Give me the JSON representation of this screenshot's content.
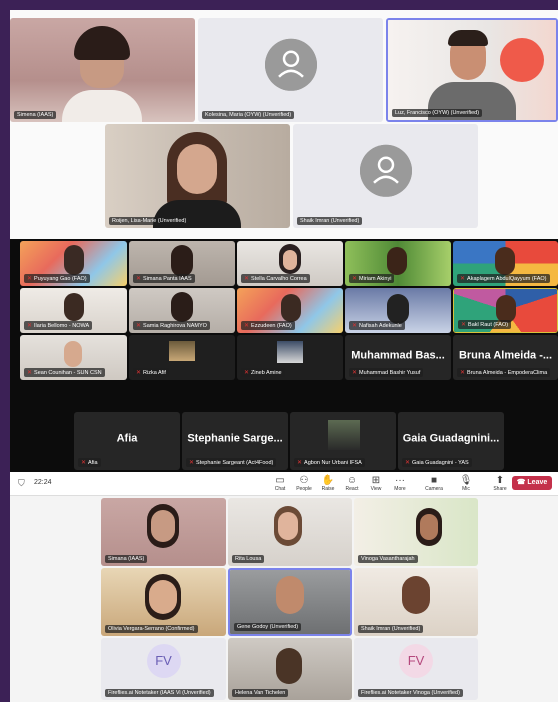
{
  "top_panel": {
    "tiles": [
      {
        "name": "Simena (IAAS)"
      },
      {
        "name": "Kolesina, Maria (OYW) (Unverified)"
      },
      {
        "name": "Luz, Francisco (OYW) (Unverified)"
      },
      {
        "name": "Roijen, Lisa-Marie (Unverified)"
      },
      {
        "name": "Shaik Imran (Unverified)"
      }
    ]
  },
  "grid_panel": {
    "tiles": [
      {
        "name": "Puyuyang Gao (FAO)"
      },
      {
        "name": "Simana Panta IAAS"
      },
      {
        "name": "Stella Carvalho Correa"
      },
      {
        "name": "Miriam Akinyi"
      },
      {
        "name": "Akaplagem AbdulQayyum (FAO)"
      },
      {
        "name": "Ilaria Bellomo - NOWA"
      },
      {
        "name": "Samia Raghirova NAMYO"
      },
      {
        "name": "Ezzudeen (FAO)"
      },
      {
        "name": "Nafisah Adekunle"
      },
      {
        "name": "Bakl Raut (FAO)"
      },
      {
        "name": "Sean Counihan - SUN CSN"
      },
      {
        "name": "Rizka Afif"
      },
      {
        "name": "Zineb Amine"
      },
      {
        "name": "Muhammad Bashir Yusuf",
        "display": "Muhammad Bas..."
      },
      {
        "name": "Bruna Almeida - EmpoderaClima",
        "display": "Bruna Almeida -..."
      },
      {
        "name": "Afia",
        "display": "Afia"
      },
      {
        "name": "Stephanie Sargeant (Act4Food)",
        "display": "Stephanie Sarge..."
      },
      {
        "name": "Agbon Nur Urbani IFSA"
      },
      {
        "name": "Gaia Guadagnini - YAS",
        "display": "Gaia Guadagnini..."
      }
    ]
  },
  "toolbar": {
    "security_label": "⛉",
    "time": "22:24",
    "items": [
      {
        "label": "Chat",
        "icon": "chat-icon"
      },
      {
        "label": "People",
        "icon": "people-icon"
      },
      {
        "label": "Raise",
        "icon": "hand-icon"
      },
      {
        "label": "React",
        "icon": "react-icon"
      },
      {
        "label": "View",
        "icon": "grid-icon"
      },
      {
        "label": "More",
        "icon": "more-icon"
      },
      {
        "label": "Camera",
        "icon": "camera-icon"
      },
      {
        "label": "Mic",
        "icon": "mic-icon"
      },
      {
        "label": "Share",
        "icon": "share-icon"
      }
    ],
    "leave_label": "Leave"
  },
  "bottom_panel": {
    "tiles": [
      {
        "name": "Simana (IAAS)"
      },
      {
        "name": "Rita Lousa"
      },
      {
        "name": "Vinoga Vasantharajah"
      },
      {
        "name": "Olivia Vergara-Serrano (Confirmed)"
      },
      {
        "name": "Gene Godoy (Unverified)"
      },
      {
        "name": "Shaik Imran (Unverified)"
      },
      {
        "name": "Fireflies.ai Notetaker (IAAS Vi (Unverified)",
        "initials": "FV"
      },
      {
        "name": "Helena Van Tichelen"
      },
      {
        "name": "Fireflies.ai Notetaker Vinoga (Unverified)",
        "initials": "FV"
      }
    ]
  },
  "colors": {
    "frame": "#3c2156",
    "leave": "#c4314b",
    "highlight": "#7b83eb"
  }
}
